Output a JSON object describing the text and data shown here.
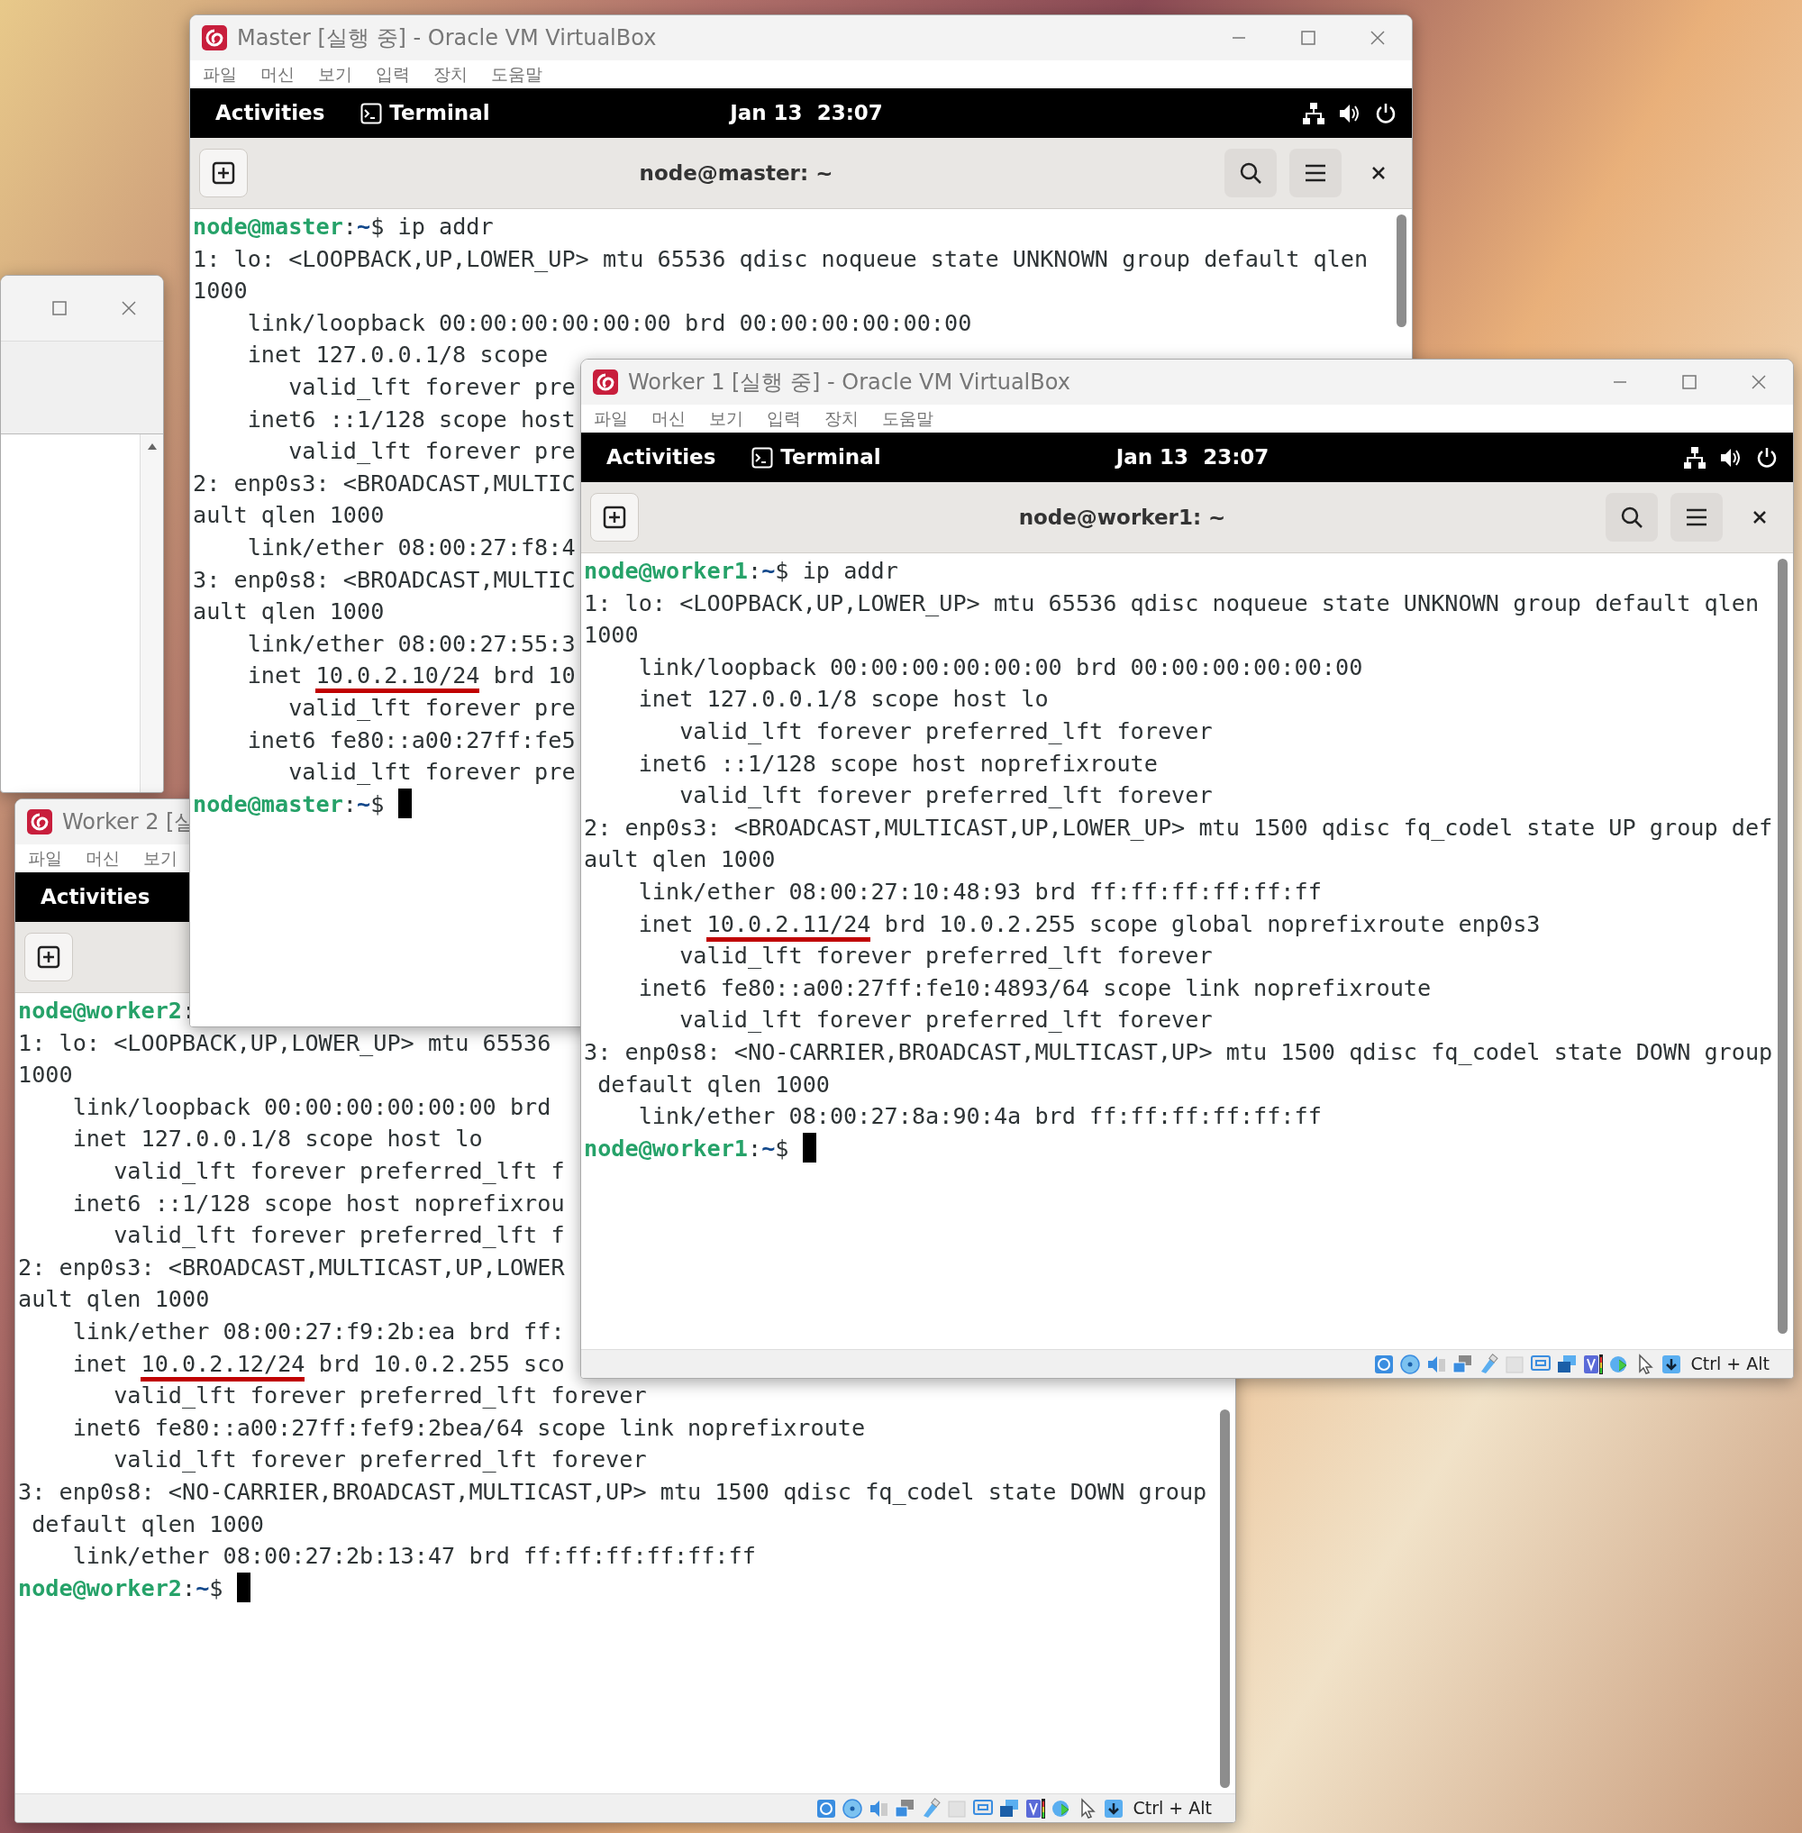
{
  "desktop": {
    "windows": [
      {
        "kind": "blank",
        "window_controls": [
          {
            "kind": "maximize"
          },
          {
            "kind": "close"
          }
        ]
      },
      {
        "kind": "vm",
        "title": "Worker 2 [실",
        "menu": [
          "파일",
          "머신",
          "보기"
        ],
        "topbar": {
          "activities": "Activities"
        },
        "terminal": {
          "lines": [
            {
              "segments": [
                {
                  "kind": "user",
                  "text": "node@worker2"
                },
                {
                  "kind": "plain",
                  "text": ":"
                }
              ]
            },
            "1: lo: <LOOPBACK,UP,LOWER_UP> mtu 65536",
            "1000",
            "    link/loopback 00:00:00:00:00:00 brd",
            "    inet 127.0.0.1/8 scope host lo",
            "       valid_lft forever preferred_lft f",
            "    inet6 ::1/128 scope host noprefixrou",
            "       valid_lft forever preferred_lft f",
            "2: enp0s3: <BROADCAST,MULTICAST,UP,LOWER",
            "ault qlen 1000",
            "    link/ether 08:00:27:f9:2b:ea brd ff:",
            {
              "segments": [
                {
                  "kind": "plain",
                  "text": "    inet "
                },
                {
                  "kind": "marked",
                  "text": "10.0.2.12/24"
                },
                {
                  "kind": "plain",
                  "text": " brd 10.0.2.255 sco"
                }
              ]
            },
            "       valid_lft forever preferred_lft forever",
            "    inet6 fe80::a00:27ff:fef9:2bea/64 scope link noprefixroute",
            "       valid_lft forever preferred_lft forever",
            "3: enp0s8: <NO-CARRIER,BROADCAST,MULTICAST,UP> mtu 1500 qdisc fq_codel state DOWN group",
            " default qlen 1000",
            "    link/ether 08:00:27:2b:13:47 brd ff:ff:ff:ff:ff:ff",
            {
              "segments": [
                {
                  "kind": "user",
                  "text": "node@worker2"
                },
                {
                  "kind": "plain",
                  "text": ":"
                },
                {
                  "kind": "path",
                  "text": "~"
                },
                {
                  "kind": "plain",
                  "text": "$ "
                },
                {
                  "kind": "cursor"
                }
              ]
            }
          ]
        },
        "status_bar": {
          "indicators": [
            {
              "kind": "disk"
            },
            {
              "kind": "disc"
            },
            {
              "kind": "audio"
            },
            {
              "kind": "network"
            },
            {
              "kind": "usb"
            },
            {
              "kind": "folder"
            },
            {
              "kind": "display"
            },
            {
              "kind": "capture"
            },
            {
              "kind": "cpu"
            },
            {
              "kind": "meter"
            },
            {
              "kind": "mouse"
            },
            {
              "kind": "keyboard"
            }
          ],
          "host_key": "Ctrl + Alt"
        }
      },
      {
        "kind": "vm",
        "title": "Master [실행 중] - Oracle VM VirtualBox",
        "window_controls": [
          {
            "kind": "minimize"
          },
          {
            "kind": "maximize"
          },
          {
            "kind": "close"
          }
        ],
        "menu": [
          "파일",
          "머신",
          "보기",
          "입력",
          "장치",
          "도움말"
        ],
        "topbar": {
          "activities": "Activities",
          "app": "Terminal",
          "clock": "Jan 13  23:07",
          "tray": [
            {
              "kind": "network"
            },
            {
              "kind": "volume"
            },
            {
              "kind": "power"
            }
          ]
        },
        "terminal": {
          "title": "node@master: ~",
          "actions": [
            {
              "kind": "search"
            },
            {
              "kind": "menu"
            },
            {
              "kind": "close"
            }
          ],
          "lines": [
            {
              "segments": [
                {
                  "kind": "user",
                  "text": "node@master"
                },
                {
                  "kind": "plain",
                  "text": ":"
                },
                {
                  "kind": "path",
                  "text": "~"
                },
                {
                  "kind": "plain",
                  "text": "$ ip addr"
                }
              ]
            },
            "1: lo: <LOOPBACK,UP,LOWER_UP> mtu 65536 qdisc noqueue state UNKNOWN group default qlen",
            "1000",
            "    link/loopback 00:00:00:00:00:00 brd 00:00:00:00:00:00",
            "    inet 127.0.0.1/8 scope",
            "       valid_lft forever pre",
            "    inet6 ::1/128 scope host",
            "       valid_lft forever pre",
            "2: enp0s3: <BROADCAST,MULTIC",
            "ault qlen 1000",
            "    link/ether 08:00:27:f8:4",
            "3: enp0s8: <BROADCAST,MULTIC",
            "ault qlen 1000",
            "    link/ether 08:00:27:55:3",
            {
              "segments": [
                {
                  "kind": "plain",
                  "text": "    inet "
                },
                {
                  "kind": "marked",
                  "text": "10.0.2.10/24"
                },
                {
                  "kind": "plain",
                  "text": " brd 10"
                }
              ]
            },
            "       valid_lft forever pre",
            "    inet6 fe80::a00:27ff:fe5",
            "       valid_lft forever pre",
            {
              "segments": [
                {
                  "kind": "user",
                  "text": "node@master"
                },
                {
                  "kind": "plain",
                  "text": ":"
                },
                {
                  "kind": "path",
                  "text": "~"
                },
                {
                  "kind": "plain",
                  "text": "$ "
                },
                {
                  "kind": "cursor"
                }
              ]
            }
          ]
        }
      },
      {
        "kind": "vm",
        "title": "Worker 1 [실행 중] - Oracle VM VirtualBox",
        "window_controls": [
          {
            "kind": "minimize"
          },
          {
            "kind": "maximize"
          },
          {
            "kind": "close"
          }
        ],
        "menu": [
          "파일",
          "머신",
          "보기",
          "입력",
          "장치",
          "도움말"
        ],
        "topbar": {
          "activities": "Activities",
          "app": "Terminal",
          "clock": "Jan 13  23:07",
          "tray": [
            {
              "kind": "network"
            },
            {
              "kind": "volume"
            },
            {
              "kind": "power"
            }
          ]
        },
        "terminal": {
          "title": "node@worker1: ~",
          "actions": [
            {
              "kind": "search"
            },
            {
              "kind": "menu"
            },
            {
              "kind": "close"
            }
          ],
          "lines": [
            {
              "segments": [
                {
                  "kind": "user",
                  "text": "node@worker1"
                },
                {
                  "kind": "plain",
                  "text": ":"
                },
                {
                  "kind": "path",
                  "text": "~"
                },
                {
                  "kind": "plain",
                  "text": "$ ip addr"
                }
              ]
            },
            "1: lo: <LOOPBACK,UP,LOWER_UP> mtu 65536 qdisc noqueue state UNKNOWN group default qlen",
            "1000",
            "    link/loopback 00:00:00:00:00:00 brd 00:00:00:00:00:00",
            "    inet 127.0.0.1/8 scope host lo",
            "       valid_lft forever preferred_lft forever",
            "    inet6 ::1/128 scope host noprefixroute",
            "       valid_lft forever preferred_lft forever",
            "2: enp0s3: <BROADCAST,MULTICAST,UP,LOWER_UP> mtu 1500 qdisc fq_codel state UP group def",
            "ault qlen 1000",
            "    link/ether 08:00:27:10:48:93 brd ff:ff:ff:ff:ff:ff",
            {
              "segments": [
                {
                  "kind": "plain",
                  "text": "    inet "
                },
                {
                  "kind": "marked",
                  "text": "10.0.2.11/24"
                },
                {
                  "kind": "plain",
                  "text": " brd 10.0.2.255 scope global noprefixroute enp0s3"
                }
              ]
            },
            "       valid_lft forever preferred_lft forever",
            "    inet6 fe80::a00:27ff:fe10:4893/64 scope link noprefixroute",
            "       valid_lft forever preferred_lft forever",
            "3: enp0s8: <NO-CARRIER,BROADCAST,MULTICAST,UP> mtu 1500 qdisc fq_codel state DOWN group",
            " default qlen 1000",
            "    link/ether 08:00:27:8a:90:4a brd ff:ff:ff:ff:ff:ff",
            {
              "segments": [
                {
                  "kind": "user",
                  "text": "node@worker1"
                },
                {
                  "kind": "plain",
                  "text": ":"
                },
                {
                  "kind": "path",
                  "text": "~"
                },
                {
                  "kind": "plain",
                  "text": "$ "
                },
                {
                  "kind": "cursor"
                }
              ]
            }
          ]
        },
        "status_bar": {
          "indicators": [
            {
              "kind": "disk"
            },
            {
              "kind": "disc"
            },
            {
              "kind": "audio"
            },
            {
              "kind": "network"
            },
            {
              "kind": "usb"
            },
            {
              "kind": "folder"
            },
            {
              "kind": "display"
            },
            {
              "kind": "capture"
            },
            {
              "kind": "cpu"
            },
            {
              "kind": "meter"
            },
            {
              "kind": "mouse"
            },
            {
              "kind": "keyboard"
            }
          ],
          "host_key": "Ctrl + Alt"
        }
      }
    ]
  }
}
